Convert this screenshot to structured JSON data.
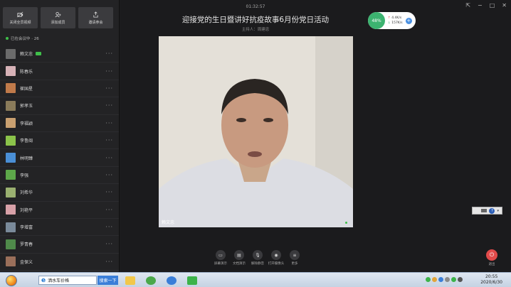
{
  "toolbar_top": {
    "buttons": [
      {
        "label": "关闭全员视频",
        "icon": "video-off-icon"
      },
      {
        "label": "添加成员",
        "icon": "add-user-icon"
      },
      {
        "label": "邀请参会",
        "icon": "share-icon"
      }
    ]
  },
  "sidebar": {
    "in_meeting_label": "已在会议中 · 26",
    "participants": [
      {
        "name": "赖文忠",
        "color": "#6b6b6b",
        "video_on": true
      },
      {
        "name": "陈春乐",
        "color": "#d7b2b7",
        "video_on": false
      },
      {
        "name": "崔国星",
        "color": "#c07a4a",
        "video_on": false
      },
      {
        "name": "郭孝玉",
        "color": "#8a7b5a",
        "video_on": false
      },
      {
        "name": "李福颖",
        "color": "#c9a070",
        "video_on": false
      },
      {
        "name": "李鲁闽",
        "color": "#8bc34a",
        "video_on": false
      },
      {
        "name": "林明臻",
        "color": "#4a8fd6",
        "video_on": false
      },
      {
        "name": "李强",
        "color": "#5da84a",
        "video_on": false
      },
      {
        "name": "刘希华",
        "color": "#9ab070",
        "video_on": false
      },
      {
        "name": "刘艳平",
        "color": "#d8a1a8",
        "video_on": false
      },
      {
        "name": "李增富",
        "color": "#7a8a9a",
        "video_on": false
      },
      {
        "name": "罗青春",
        "color": "#4f8a4a",
        "video_on": false
      },
      {
        "name": "金保义",
        "color": "#9a6f5a",
        "video_on": false
      }
    ]
  },
  "meeting": {
    "timer": "01:32:57",
    "title": "迎接党的生日暨讲好抗疫故事6月份党日活动",
    "host": "主持人：周建忠",
    "speaker_name": "赖文忠"
  },
  "network": {
    "percent": "48%",
    "upload": "4.4K/s",
    "download": "157K/s"
  },
  "bottom_toolbar": {
    "tools": [
      {
        "label": "屏幕演示",
        "icon": "screen-share-icon"
      },
      {
        "label": "文档演示",
        "icon": "document-icon"
      },
      {
        "label": "解除静音",
        "icon": "mic-icon"
      },
      {
        "label": "打开摄像头",
        "icon": "camera-icon"
      },
      {
        "label": "更多",
        "icon": "more-icon"
      }
    ],
    "leave_label": "退出"
  },
  "taskbar": {
    "search_text": "洒水车价格",
    "search_button": "搜索一下",
    "time": "20:55",
    "date": "2020/6/30"
  }
}
